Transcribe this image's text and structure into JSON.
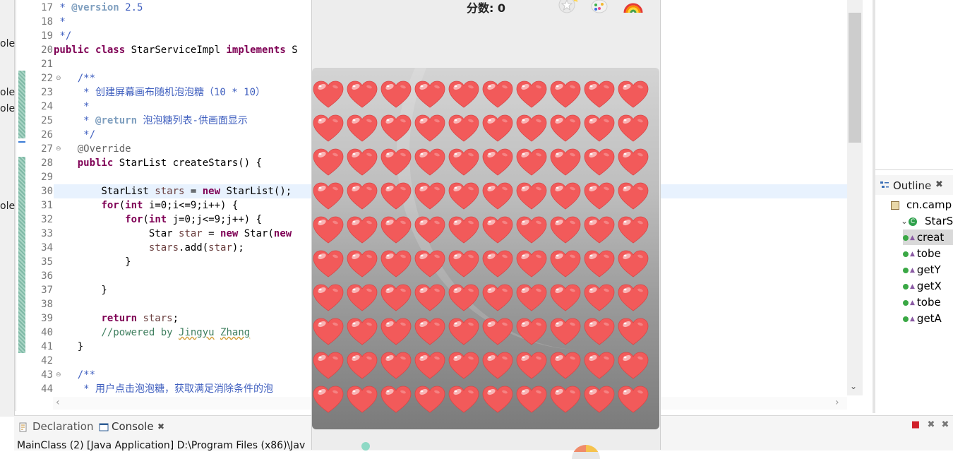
{
  "editor": {
    "lines": [
      {
        "n": "17",
        "tokens": [
          {
            "t": " * ",
            "c": "cm"
          },
          {
            "t": "@version",
            "c": "tag"
          },
          {
            "t": " 2.5",
            "c": "cm"
          }
        ]
      },
      {
        "n": "18",
        "tokens": [
          {
            "t": " *",
            "c": "cm"
          }
        ]
      },
      {
        "n": "19",
        "tokens": [
          {
            "t": " */",
            "c": "cm"
          }
        ]
      },
      {
        "n": "20",
        "tokens": [
          {
            "t": "public",
            "c": "kw"
          },
          {
            "t": " "
          },
          {
            "t": "class",
            "c": "kw"
          },
          {
            "t": " StarServiceImpl "
          },
          {
            "t": "implements",
            "c": "kw"
          },
          {
            "t": " S"
          }
        ]
      },
      {
        "n": "21",
        "tokens": []
      },
      {
        "n": "22",
        "fold": true,
        "tokens": [
          {
            "t": "    /**",
            "c": "cm"
          }
        ]
      },
      {
        "n": "23",
        "tokens": [
          {
            "t": "     * 创建屏幕画布随机泡泡糖（10 * 10）",
            "c": "cm"
          }
        ]
      },
      {
        "n": "24",
        "tokens": [
          {
            "t": "     *",
            "c": "cm"
          }
        ]
      },
      {
        "n": "25",
        "tokens": [
          {
            "t": "     * ",
            "c": "cm"
          },
          {
            "t": "@return",
            "c": "tag"
          },
          {
            "t": " 泡泡糖列表-供画面显示",
            "c": "cm"
          }
        ]
      },
      {
        "n": "26",
        "tokens": [
          {
            "t": "     */",
            "c": "cm"
          }
        ]
      },
      {
        "n": "27",
        "fold": true,
        "tokens": [
          {
            "t": "    @Override",
            "c": "ann"
          }
        ]
      },
      {
        "n": "28",
        "tokens": [
          {
            "t": "    "
          },
          {
            "t": "public",
            "c": "kw"
          },
          {
            "t": " StarList createStars() {"
          }
        ]
      },
      {
        "n": "29",
        "tokens": []
      },
      {
        "n": "30",
        "hl": true,
        "tokens": [
          {
            "t": "        StarList "
          },
          {
            "t": "stars",
            "c": "var"
          },
          {
            "t": " = "
          },
          {
            "t": "new",
            "c": "kw"
          },
          {
            "t": " StarList();"
          }
        ]
      },
      {
        "n": "31",
        "tokens": [
          {
            "t": "        "
          },
          {
            "t": "for",
            "c": "kw"
          },
          {
            "t": "("
          },
          {
            "t": "int",
            "c": "kw"
          },
          {
            "t": " i=0;i<=9;i++) {"
          }
        ]
      },
      {
        "n": "32",
        "tokens": [
          {
            "t": "            "
          },
          {
            "t": "for",
            "c": "kw"
          },
          {
            "t": "("
          },
          {
            "t": "int",
            "c": "kw"
          },
          {
            "t": " j=0;j<=9;j++) {"
          }
        ]
      },
      {
        "n": "33",
        "tokens": [
          {
            "t": "                Star "
          },
          {
            "t": "star",
            "c": "var"
          },
          {
            "t": " = "
          },
          {
            "t": "new",
            "c": "kw"
          },
          {
            "t": " Star("
          },
          {
            "t": "new",
            "c": "kw"
          }
        ]
      },
      {
        "n": "34",
        "tokens": [
          {
            "t": "                "
          },
          {
            "t": "stars",
            "c": "var"
          },
          {
            "t": ".add("
          },
          {
            "t": "star",
            "c": "var"
          },
          {
            "t": ");"
          }
        ]
      },
      {
        "n": "35",
        "tokens": [
          {
            "t": "            }"
          }
        ]
      },
      {
        "n": "36",
        "tokens": []
      },
      {
        "n": "37",
        "tokens": [
          {
            "t": "        }"
          }
        ]
      },
      {
        "n": "38",
        "tokens": []
      },
      {
        "n": "39",
        "tokens": [
          {
            "t": "        "
          },
          {
            "t": "return",
            "c": "kw"
          },
          {
            "t": " "
          },
          {
            "t": "stars",
            "c": "var"
          },
          {
            "t": ";"
          }
        ]
      },
      {
        "n": "40",
        "tokens": [
          {
            "t": "        //powered by ",
            "c": "lc"
          },
          {
            "t": "Jingyu",
            "c": "lc sq"
          },
          {
            "t": " ",
            "c": "lc"
          },
          {
            "t": "Zhang",
            "c": "lc sq"
          }
        ]
      },
      {
        "n": "41",
        "tokens": [
          {
            "t": "    }"
          }
        ]
      },
      {
        "n": "42",
        "tokens": []
      },
      {
        "n": "43",
        "fold": true,
        "tokens": [
          {
            "t": "    /**",
            "c": "cm"
          }
        ]
      },
      {
        "n": "44",
        "tokens": [
          {
            "t": "     * 用户点击泡泡糖，获取满足消除条件的泡",
            "c": "cm"
          }
        ]
      }
    ]
  },
  "left_fragments": [
    "ole",
    "ole",
    "ole",
    "ole"
  ],
  "game": {
    "score_label": "分数:",
    "score_value": "0",
    "rows": 10,
    "cols": 10,
    "toolbar_icons": [
      "star-icon",
      "palette-icon",
      "rainbow-icon"
    ]
  },
  "outline": {
    "tab_label": "Outline",
    "items": [
      {
        "label": "cn.camp",
        "kind": "package"
      },
      {
        "label": "StarSer",
        "kind": "class"
      },
      {
        "label": "creat",
        "kind": "method",
        "selected": true
      },
      {
        "label": "tobe",
        "kind": "method"
      },
      {
        "label": "getY",
        "kind": "method"
      },
      {
        "label": "getX",
        "kind": "method"
      },
      {
        "label": "tobe",
        "kind": "method"
      },
      {
        "label": "getA",
        "kind": "method"
      }
    ]
  },
  "bottom": {
    "declaration_tab": "Declaration",
    "console_tab": "Console",
    "console_line": "MainClass (2) [Java Application] D:\\Program Files (x86)\\Jav"
  },
  "colors": {
    "keyword": "#7f0055",
    "comment": "#3f5fbf",
    "heart": "#f25a5a"
  }
}
